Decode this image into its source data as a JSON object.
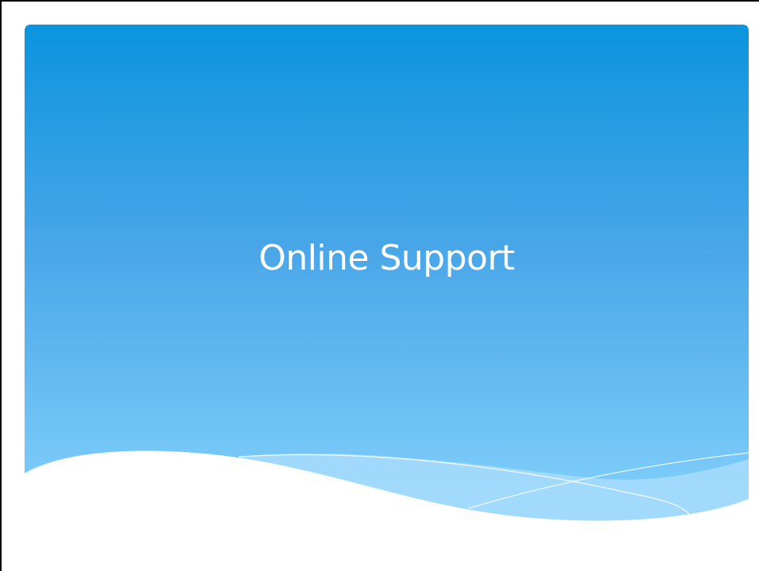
{
  "slide": {
    "title": "Online Support"
  },
  "theme": {
    "gradient_top": "#0b94df",
    "gradient_bottom": "#86d3fd",
    "wave_light": "#a7dcfb",
    "background": "#ffffff"
  }
}
